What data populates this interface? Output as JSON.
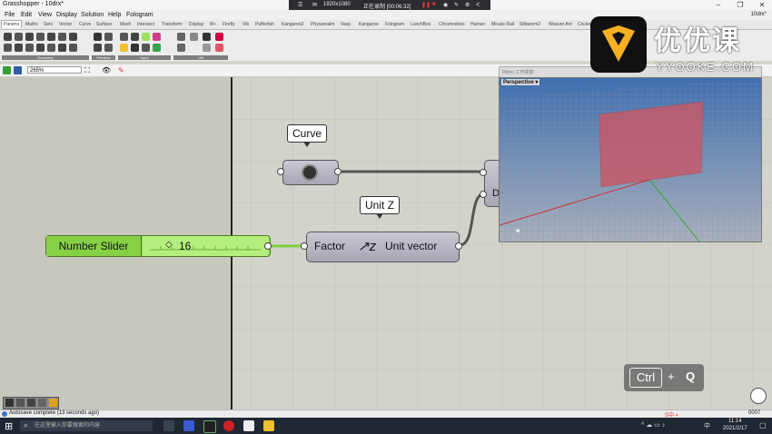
{
  "titlebar": {
    "app_title": "Grasshopper - 10drx*",
    "resolution": "1920x1080",
    "recording": "正在录制 [00:06:32]"
  },
  "menu": [
    "File",
    "Edit",
    "View",
    "Display",
    "Solution",
    "Help",
    "Fologram"
  ],
  "doc_name": "10drx*",
  "tabs": [
    "Params",
    "Maths",
    "Sets",
    "Vector",
    "Curve",
    "Surface",
    "Mesh",
    "Intersect",
    "Transform",
    "Display",
    "M+",
    "Firefly",
    "Vib",
    "Pufferfish",
    "Kangaroo2",
    "Physarealm",
    "Vasp",
    "Kangaroo",
    "Fologram",
    "LunchBox",
    "Chromodoris",
    "Human",
    "Mouse Rail",
    "Silkworm2",
    "Weaver Ant",
    "Crickot"
  ],
  "groups": [
    "Geometry",
    "Primitive",
    "Input",
    "Util"
  ],
  "zoom": "265%",
  "canvas": {
    "curve_callout": "Curve",
    "unitz_callout": "Unit Z",
    "unitz_input": "Factor",
    "unitz_output": "Unit vector",
    "partial_input": "D",
    "slider_name": "Number Slider",
    "slider_value": "16",
    "slider_value_num": 16
  },
  "rhino": {
    "title": "Rhino 工作视窗",
    "viewport": "Perspective"
  },
  "logo": {
    "name": "优优课",
    "url": "YYOOKE.COM"
  },
  "overlay": {
    "key1": "Ctrl",
    "plus": "+",
    "key2": "Q"
  },
  "status": {
    "message": "Autosave complete (13 seconds ago)",
    "right_value": "0007"
  },
  "taskbar": {
    "search_placeholder": "在这里输入你要搜索的内容",
    "time": "11:14",
    "date": "2021/2/17",
    "lang": "中"
  },
  "colors": {
    "slider_green": "#9be25a",
    "logo_orange": "#f6b021",
    "canvas_bg": "#d4d3cb"
  }
}
